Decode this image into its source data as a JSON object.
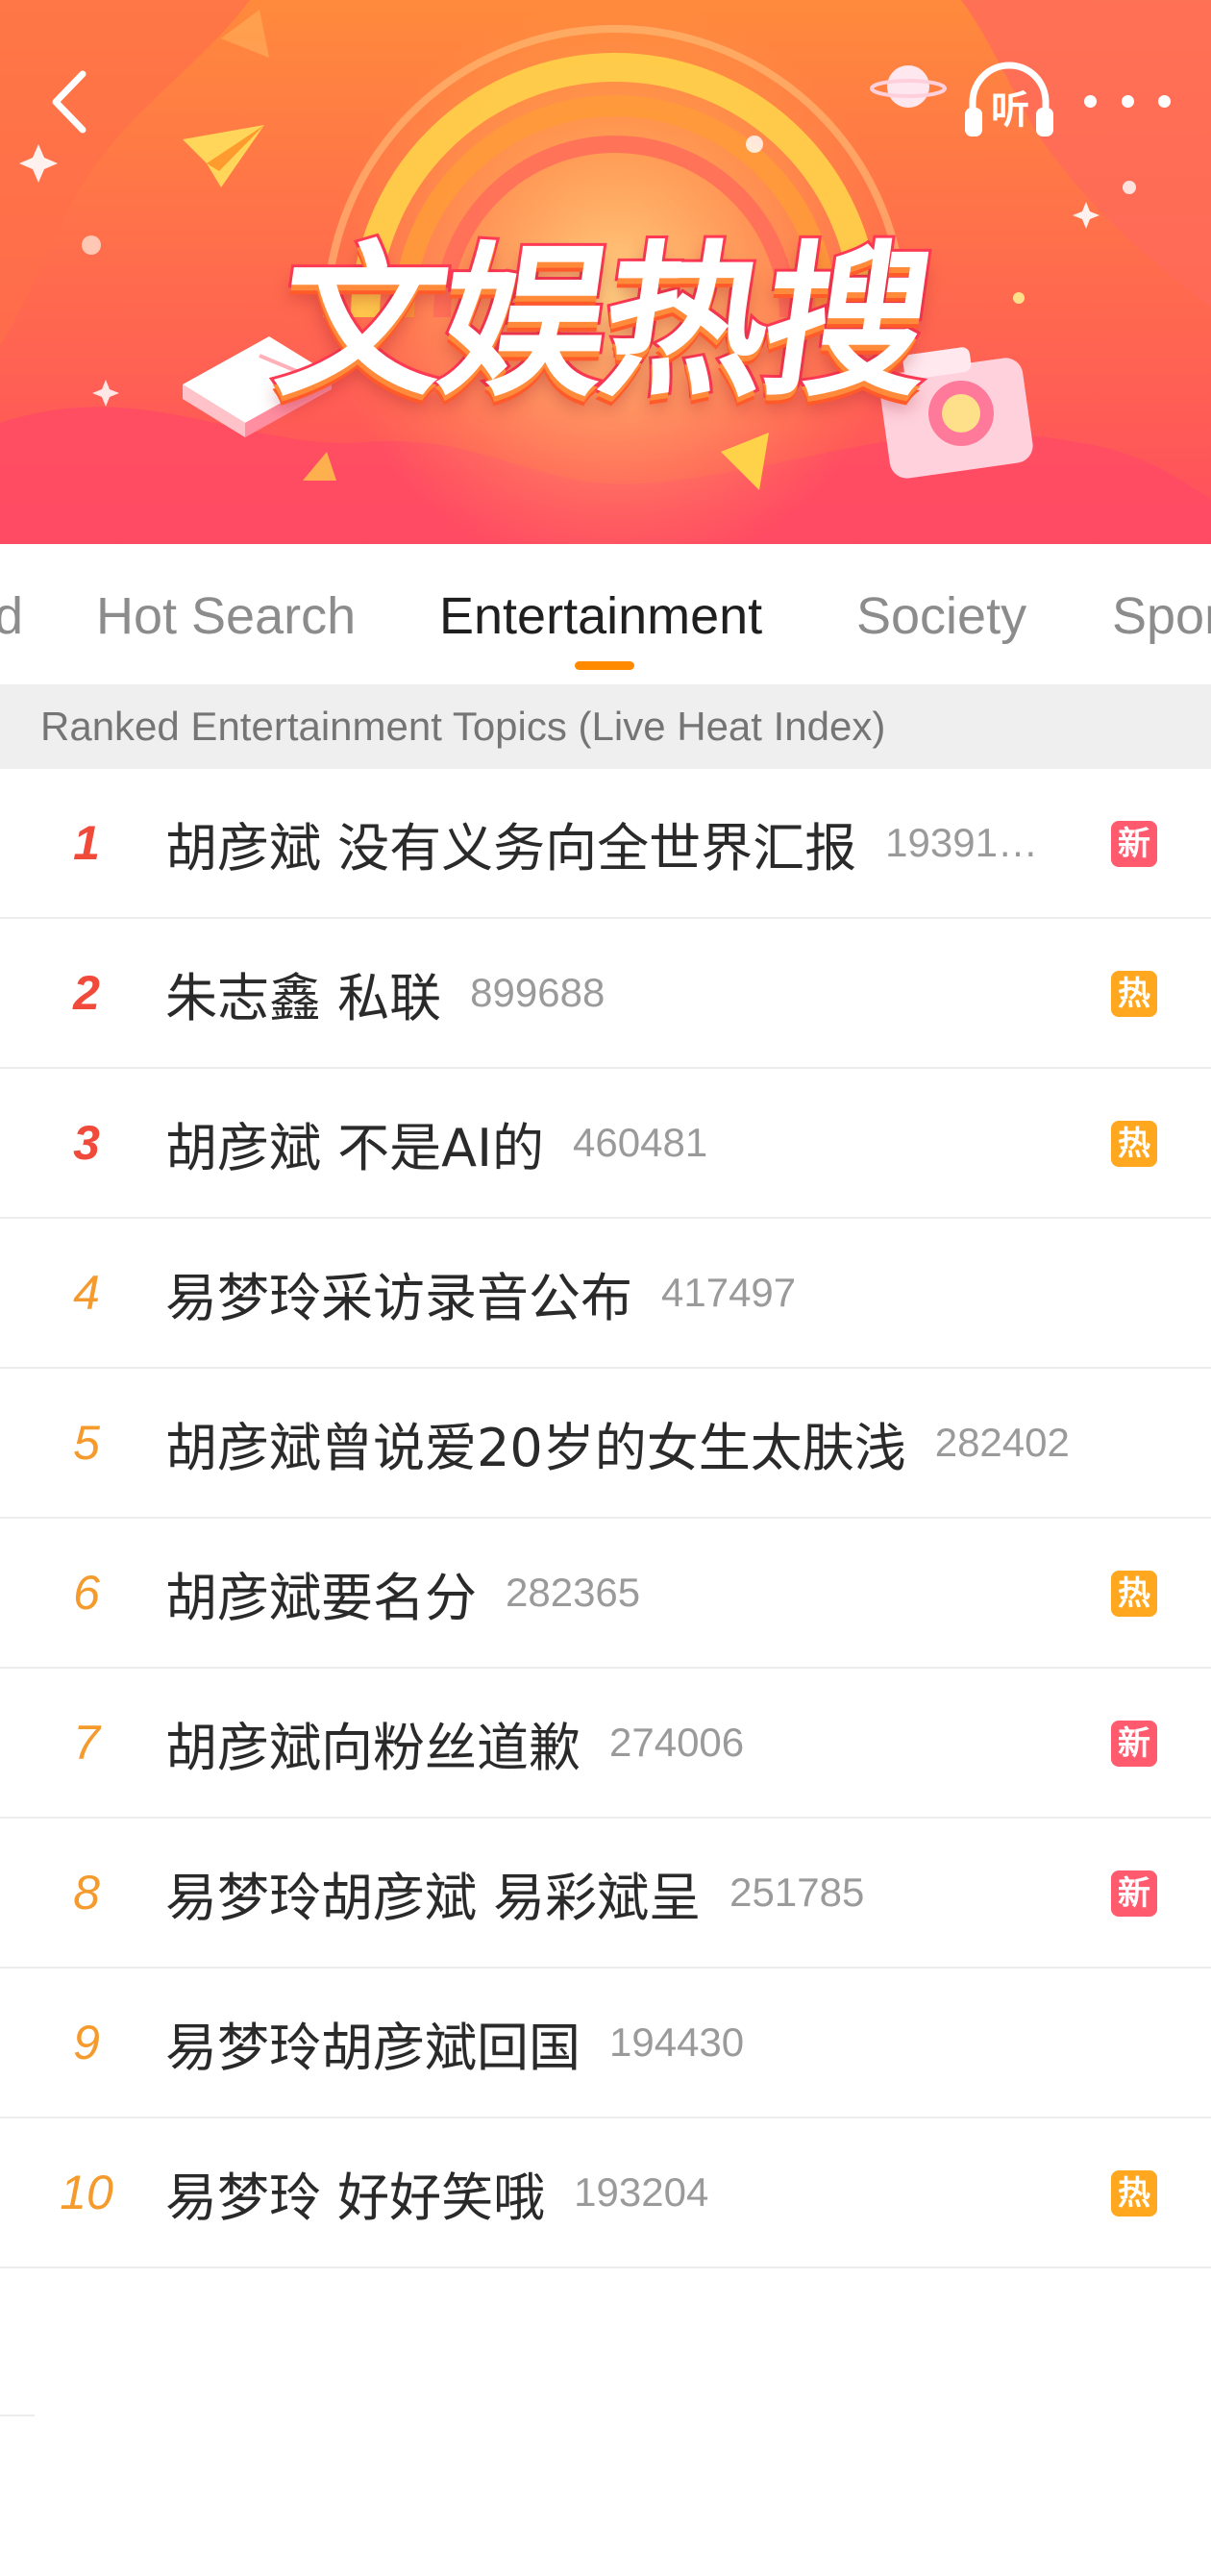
{
  "header": {
    "title": "文娱热搜",
    "listen_label": "听",
    "icons": {
      "back": "chevron-left-icon",
      "listen": "headphones-icon",
      "more": "more-dots-icon"
    },
    "colors": {
      "banner_top": "#ff6a4a",
      "banner_bottom": "#ff3f6a"
    }
  },
  "tabs": [
    {
      "label": "d",
      "active": false
    },
    {
      "label": "Hot Search",
      "active": false
    },
    {
      "label": "Entertainment",
      "active": true
    },
    {
      "label": "Society",
      "active": false
    },
    {
      "label": "Spor",
      "active": false
    }
  ],
  "section_header": "Ranked Entertainment Topics (Live Heat Index)",
  "list": [
    {
      "rank": "1",
      "topic": "胡彦斌 没有义务向全世界汇报",
      "heat": "19391…",
      "badge": "新",
      "badge_type": "new"
    },
    {
      "rank": "2",
      "topic": "朱志鑫 私联",
      "heat": "899688",
      "badge": "热",
      "badge_type": "hot"
    },
    {
      "rank": "3",
      "topic": "胡彦斌 不是AI的",
      "heat": "460481",
      "badge": "热",
      "badge_type": "hot"
    },
    {
      "rank": "4",
      "topic": "易梦玲采访录音公布",
      "heat": "417497",
      "badge": "",
      "badge_type": ""
    },
    {
      "rank": "5",
      "topic": "胡彦斌曾说爱20岁的女生太肤浅",
      "heat": "282402",
      "badge": "",
      "badge_type": ""
    },
    {
      "rank": "6",
      "topic": "胡彦斌要名分",
      "heat": "282365",
      "badge": "热",
      "badge_type": "hot"
    },
    {
      "rank": "7",
      "topic": "胡彦斌向粉丝道歉",
      "heat": "274006",
      "badge": "新",
      "badge_type": "new"
    },
    {
      "rank": "8",
      "topic": "易梦玲胡彦斌 易彩斌呈",
      "heat": "251785",
      "badge": "新",
      "badge_type": "new"
    },
    {
      "rank": "9",
      "topic": "易梦玲胡彦斌回国",
      "heat": "194430",
      "badge": "",
      "badge_type": ""
    },
    {
      "rank": "10",
      "topic": "易梦玲 好好笑哦",
      "heat": "193204",
      "badge": "热",
      "badge_type": "hot"
    }
  ],
  "colors": {
    "rank_top": "#f04a3a",
    "rank_rest": "#f59a2c",
    "badge_new": "#ff5a6e",
    "badge_hot": "#ffa81f",
    "tab_indicator": "#ff8a00"
  }
}
